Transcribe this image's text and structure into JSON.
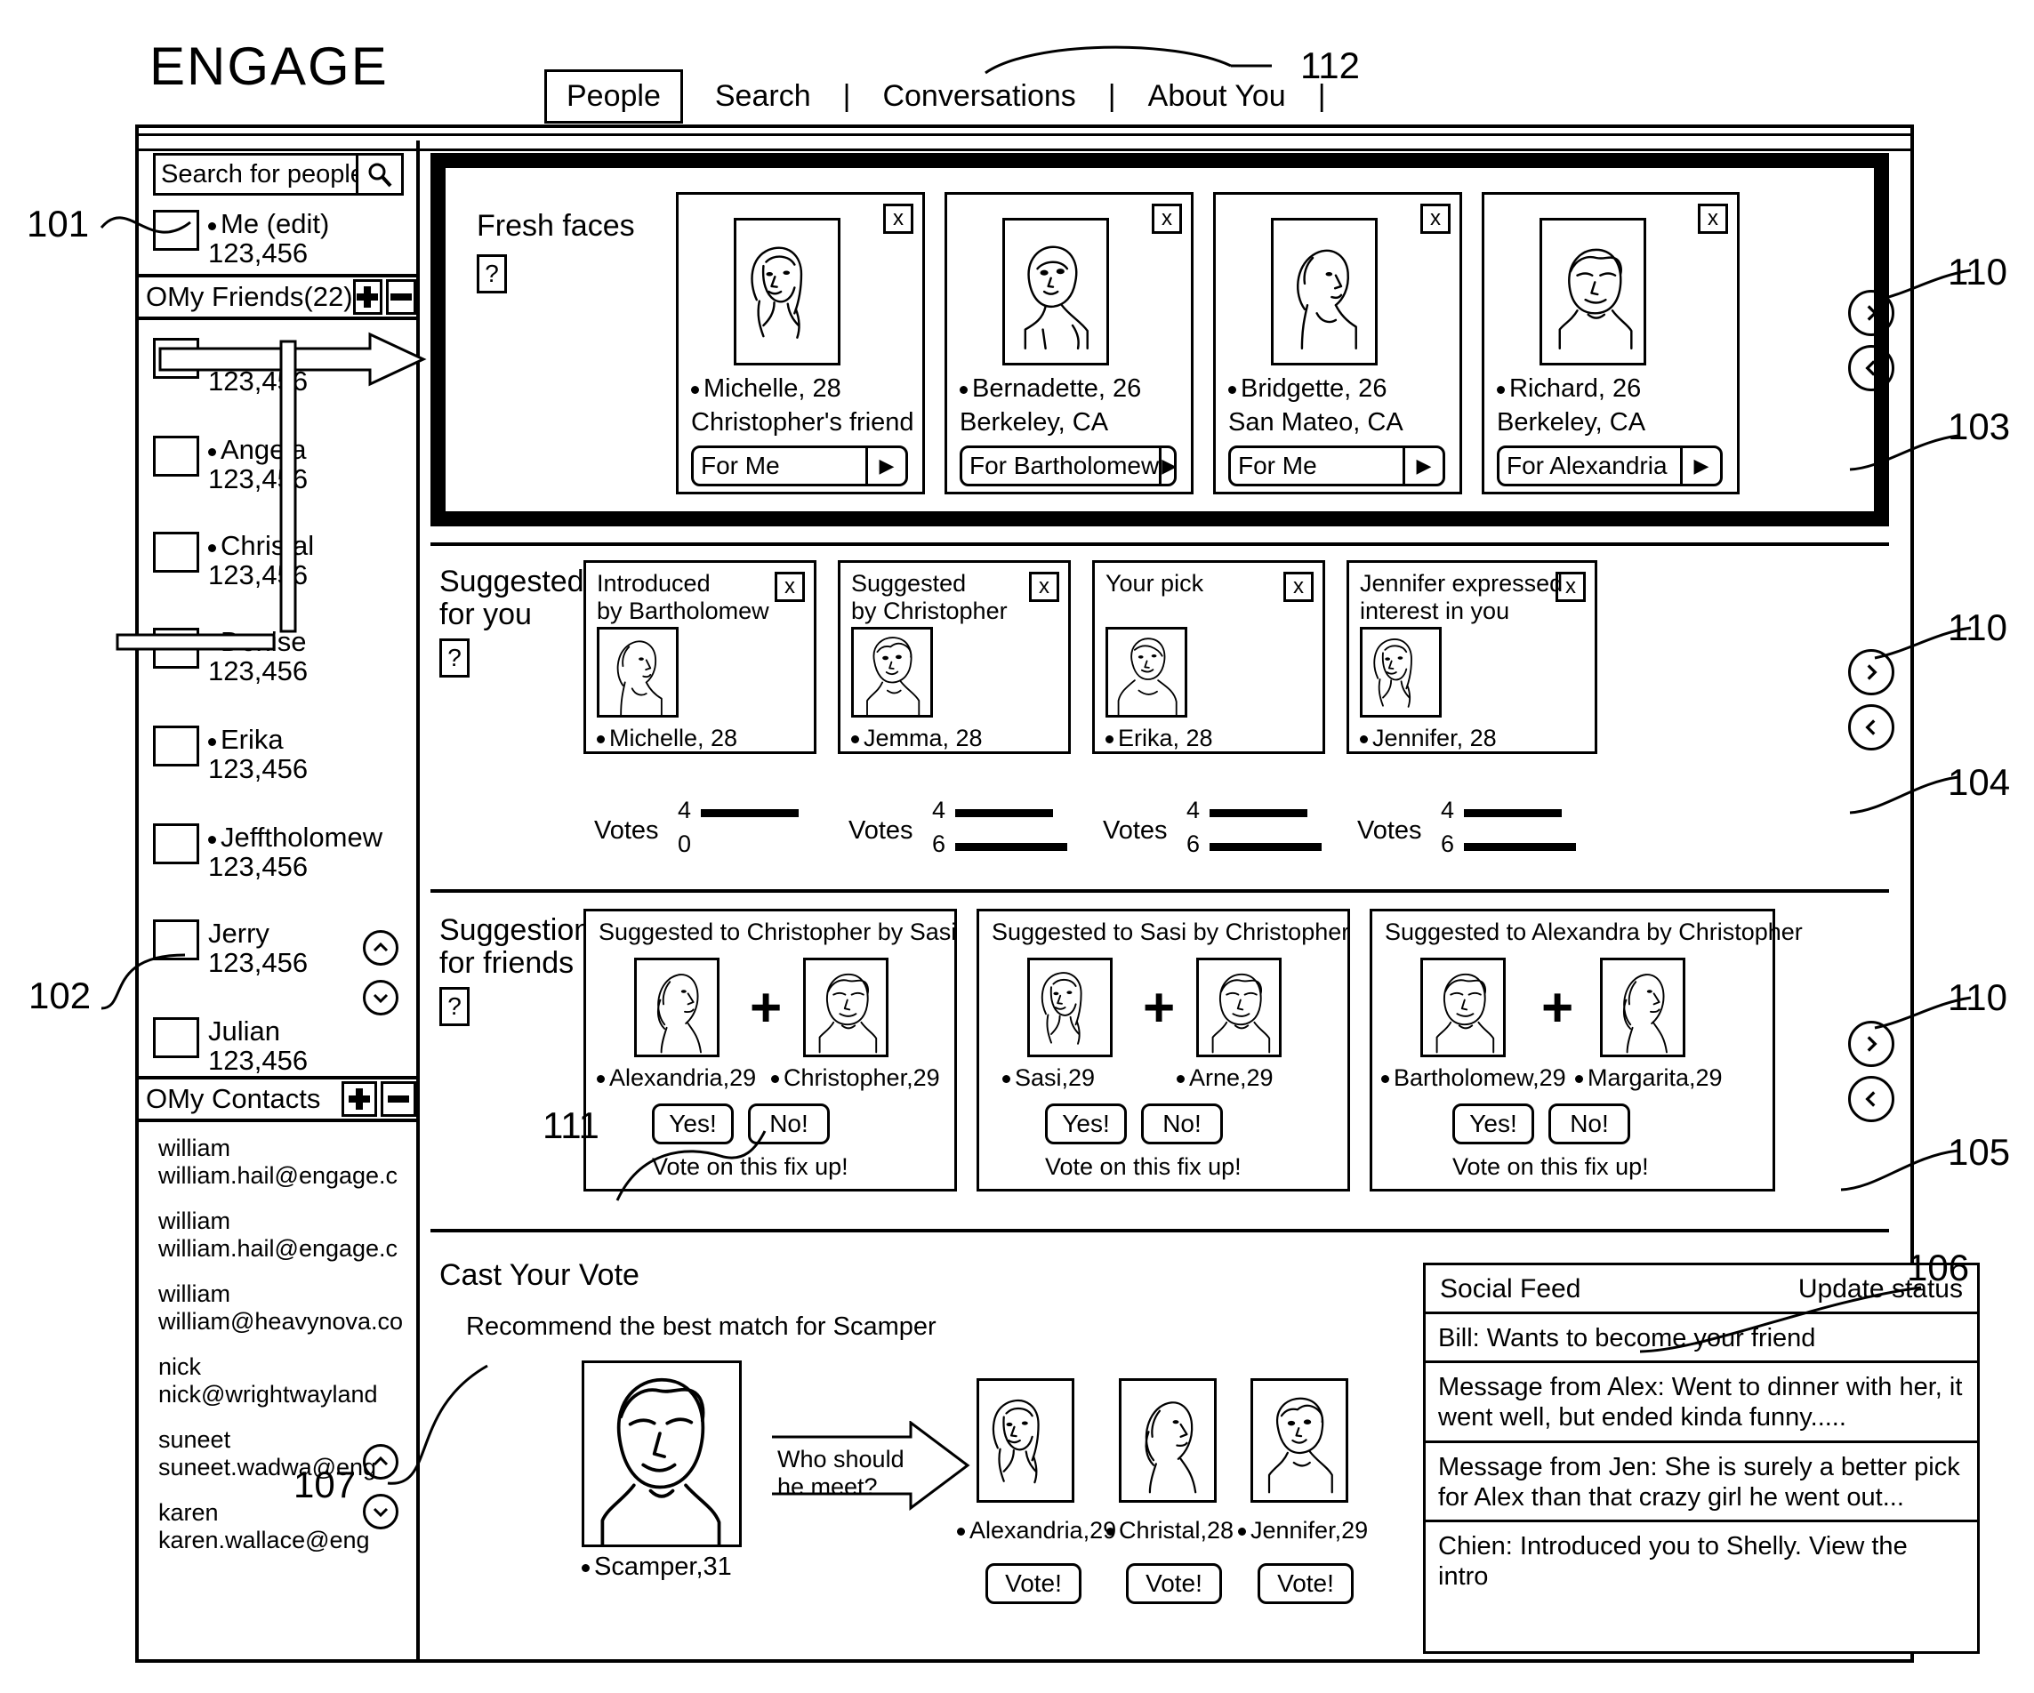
{
  "brand": "ENGAGE",
  "nav": {
    "tabs": [
      "People",
      "Search",
      "Conversations",
      "About You"
    ],
    "sep": "|"
  },
  "callouts": {
    "c101": "101",
    "c102": "102",
    "c103": "103",
    "c104": "104",
    "c105": "105",
    "c106": "106",
    "c107": "107",
    "c110a": "110",
    "c110b": "110",
    "c110c": "110",
    "c111": "111",
    "c112": "112"
  },
  "sidebar": {
    "search": {
      "placeholder": "Search for people",
      "icon": "search-icon"
    },
    "me": {
      "name": "Me (edit)",
      "id": "123,456"
    },
    "friends_header": {
      "title": "OMy Friends(22)",
      "add": "+",
      "remove": "-"
    },
    "friends": [
      {
        "name": "",
        "id": "123,456"
      },
      {
        "name": "Angela",
        "id": "123,456"
      },
      {
        "name": "Christal",
        "id": "123,456"
      },
      {
        "name": "Denise",
        "id": "123,456"
      },
      {
        "name": "Erika",
        "id": "123,456"
      },
      {
        "name": "Jefftholomew",
        "id": "123,456"
      },
      {
        "name": "Jerry",
        "id": "123,456"
      },
      {
        "name": "Julian",
        "id": "123,456"
      }
    ],
    "contacts_header": {
      "title": "OMy Contacts",
      "add": "+",
      "remove": "-"
    },
    "contacts": [
      {
        "name": "william",
        "email": "william.hail@engage.c"
      },
      {
        "name": "william",
        "email": "william.hail@engage.c"
      },
      {
        "name": "william",
        "email": "william@heavynova.co"
      },
      {
        "name": "nick",
        "email": "nick@wrightwayland"
      },
      {
        "name": "suneet",
        "email": "suneet.wadwa@eng"
      },
      {
        "name": "karen",
        "email": "karen.wallace@eng"
      }
    ],
    "scroll_up": "▲",
    "scroll_down": "▼"
  },
  "fresh_faces": {
    "title": "Fresh faces",
    "help": "?",
    "cards": [
      {
        "name": "Michelle, 28",
        "sub": "Christopher's friend",
        "select": "For Me",
        "close": "x",
        "avatar": "woman-long-hair"
      },
      {
        "name": "Bernadette, 26",
        "sub": "Berkeley, CA",
        "select": "For Bartholomew",
        "close": "x",
        "avatar": "woman-bob-hair"
      },
      {
        "name": "Bridgette, 26",
        "sub": "San Mateo, CA",
        "select": "For Me",
        "close": "x",
        "avatar": "man-profile"
      },
      {
        "name": "Richard, 26",
        "sub": "Berkeley, CA",
        "select": "For Alexandria",
        "close": "x",
        "avatar": "man-front"
      }
    ]
  },
  "suggested_for_you": {
    "title": "Suggested\nfor you",
    "title_l1": "Suggested",
    "title_l2": "for you",
    "help": "?",
    "votes_label": "Votes",
    "cards": [
      {
        "header_l1": "Introduced",
        "header_l2": "by Bartholomew",
        "name": "Michelle, 28",
        "close": "x",
        "vote_top": "4",
        "vote_bottom": "0",
        "bar_top_pct": 72,
        "bar_bottom_pct": 0,
        "avatar": "man-profile"
      },
      {
        "header_l1": "Suggested",
        "header_l2": "by Christopher",
        "name": "Jemma, 28",
        "close": "x",
        "vote_top": "4",
        "vote_bottom": "6",
        "bar_top_pct": 72,
        "bar_bottom_pct": 86,
        "avatar": "woman-curly"
      },
      {
        "header_l1": "Your pick",
        "header_l2": "",
        "name": "Erika, 28",
        "close": "x",
        "vote_top": "4",
        "vote_bottom": "6",
        "bar_top_pct": 72,
        "bar_bottom_pct": 86,
        "avatar": "woman-shoulders"
      },
      {
        "header_l1": "Jennifer expressed",
        "header_l2": "interest in you",
        "name": "Jennifer, 28",
        "close": "x",
        "vote_top": "4",
        "vote_bottom": "6",
        "bar_top_pct": 72,
        "bar_bottom_pct": 86,
        "avatar": "woman-long-hair"
      }
    ]
  },
  "suggestions_for_friends": {
    "title_l1": "Suggestions",
    "title_l2": "for friends",
    "help": "?",
    "cards": [
      {
        "header": "Suggested to Christopher by Sasi",
        "left_name": "Alexandria,29",
        "right_name": "Christopher,29",
        "plus": "+",
        "yes": "Yes!",
        "no": "No!",
        "footer": "Vote on this fix up!",
        "left_avatar": "woman-profile",
        "right_avatar": "man-front"
      },
      {
        "header": "Suggested to Sasi by Christopher",
        "left_name": "Sasi,29",
        "right_name": "Arne,29",
        "plus": "+",
        "yes": "Yes!",
        "no": "No!",
        "footer": "Vote on this fix up!",
        "left_avatar": "woman-long-hair",
        "right_avatar": "man-front"
      },
      {
        "header": "Suggested to Alexandra by Christopher",
        "left_name": "Bartholomew,29",
        "right_name": "Margarita,29",
        "plus": "+",
        "yes": "Yes!",
        "no": "No!",
        "footer": "Vote on this fix up!",
        "left_avatar": "man-front",
        "right_avatar": "woman-profile"
      }
    ]
  },
  "cast_your_vote": {
    "title": "Cast Your Vote",
    "subtitle": "Recommend the best match for Scamper",
    "subject": {
      "name": "Scamper,31",
      "avatar": "man-big"
    },
    "arrow_l1": "Who should",
    "arrow_l2": "he meet?",
    "candidates": [
      {
        "name": "Alexandria,29",
        "button": "Vote!",
        "avatar": "woman-long-hair"
      },
      {
        "name": "Christal,28",
        "button": "Vote!",
        "avatar": "woman-profile"
      },
      {
        "name": "Jennifer,29",
        "button": "Vote!",
        "avatar": "woman-curly"
      }
    ]
  },
  "social_feed": {
    "title": "Social Feed",
    "update_status": "Update status",
    "items": [
      "Bill: Wants to become your friend",
      "Message from Alex: Went to dinner with her, it went well, but ended kinda funny.....",
      "Message from Jen: She is surely a better pick for Alex than that crazy girl he went out...",
      "Chien: Introduced you to Shelly. View the intro"
    ]
  },
  "pagers": {
    "next": "›",
    "prev": "‹"
  }
}
